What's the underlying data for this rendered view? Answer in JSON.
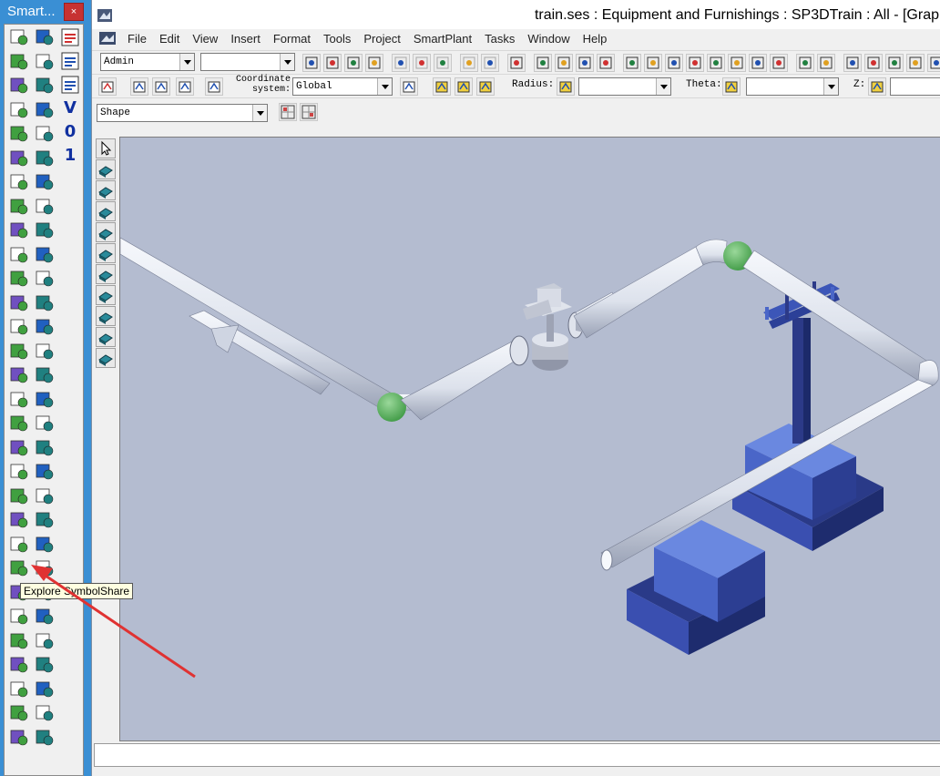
{
  "palette": {
    "title": "Smart...",
    "close_label": "×",
    "glyph_buttons": [
      "V",
      "0",
      "1"
    ],
    "tooltip": "Explore SymbolShare"
  },
  "window": {
    "title": "train.ses : Equipment and Furnishings : SP3DTrain : All - [Grap"
  },
  "menu": {
    "items": [
      "File",
      "Edit",
      "View",
      "Insert",
      "Format",
      "Tools",
      "Project",
      "SmartPlant",
      "Tasks",
      "Window",
      "Help"
    ]
  },
  "toolbar1": {
    "permission_group": "Admin",
    "second_combo": ""
  },
  "toolbar2": {
    "coordinate_label": "Coordinate system:",
    "coordinate_value": "Global",
    "radius_label": "Radius:",
    "radius_value": "",
    "theta_label": "Theta:",
    "theta_value": "",
    "z_label": "Z:",
    "z_value": ""
  },
  "toolbar3": {
    "shape_value": "Shape"
  },
  "colors": {
    "viewport_bg": "#b4bcd0",
    "pipe": "#e6eaf2",
    "equipment_blue": "#5a7ad4",
    "elbow_green": "#5fb85f",
    "annotation_red": "#e03232"
  }
}
